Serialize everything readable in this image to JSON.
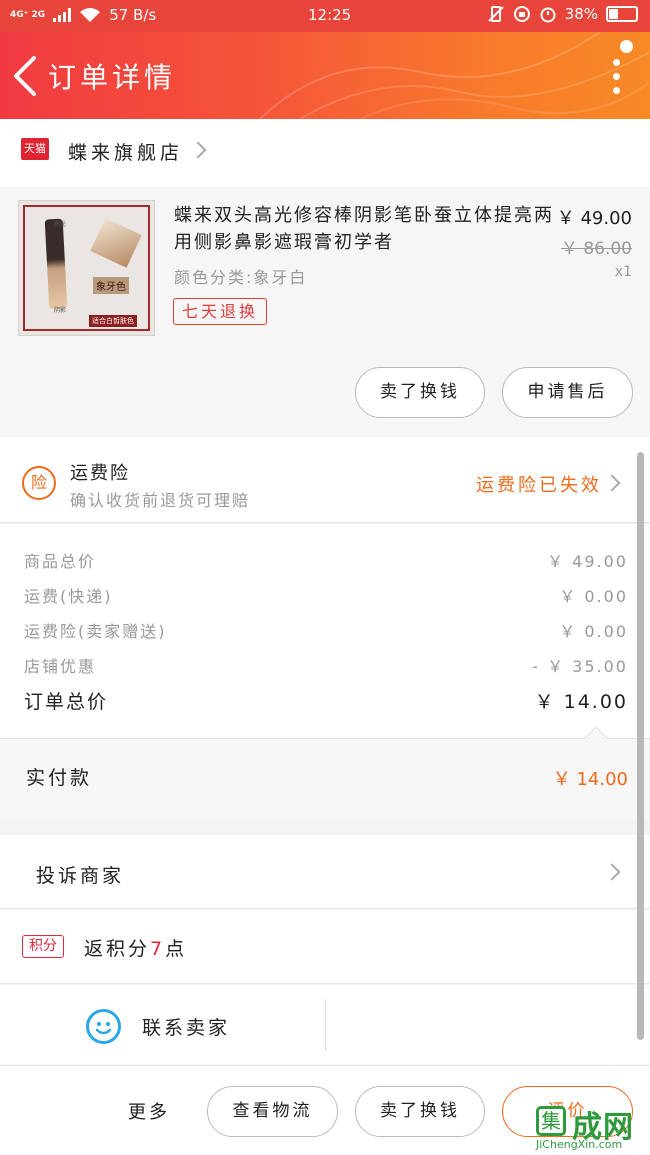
{
  "status_bar": {
    "network": "4G⁺ 2G",
    "speed": "57 B/s",
    "time": "12:25",
    "battery": "38%"
  },
  "header": {
    "title": "订单详情"
  },
  "store": {
    "badge": "天猫",
    "name": "蝶来旗舰店"
  },
  "product": {
    "title": "蝶来双头高光修容棒阴影笔卧蚕立体提亮两用侧影鼻影遮瑕膏初学者",
    "price": "￥ 49.00",
    "original_price": "￥ 86.00",
    "quantity": "x1",
    "spec": "颜色分类:象牙白",
    "tag": "七天退换",
    "thumb_labels": [
      "高光",
      "阴影",
      "象牙色",
      "适合白皙肤色"
    ]
  },
  "order_actions": {
    "repurchase": "卖了换钱",
    "after_sale": "申请售后"
  },
  "insurance": {
    "icon": "险",
    "title": "运费险",
    "subtitle": "确认收货前退货可理赔",
    "status": "运费险已失效"
  },
  "summary": {
    "rows": [
      {
        "label": "商品总价",
        "value": "￥ 49.00"
      },
      {
        "label": "运费(快递)",
        "value": "￥ 0.00"
      },
      {
        "label": "运费险(卖家赠送)",
        "value": "￥ 0.00"
      },
      {
        "label": "店铺优惠",
        "value": "- ￥ 35.00"
      }
    ],
    "total_label": "订单总价",
    "total_value": "￥ 14.00"
  },
  "paid": {
    "label": "实付款",
    "value": "￥ 14.00"
  },
  "complain": {
    "label": "投诉商家"
  },
  "points": {
    "badge": "积分",
    "prefix": "返积分",
    "count": "7",
    "suffix": "点"
  },
  "contact": {
    "label": "联系卖家"
  },
  "bottom_bar": {
    "more": "更多",
    "logistics": "查看物流",
    "sell": "卖了换钱",
    "review": "评价"
  },
  "watermark": {
    "logo": "集",
    "text": "成网",
    "url": "JiChengXin.com"
  },
  "colors": {
    "accent": "#f06a1b",
    "brand_red": "#e02330",
    "header_start": "#f03a40",
    "header_end": "#f78a25"
  }
}
